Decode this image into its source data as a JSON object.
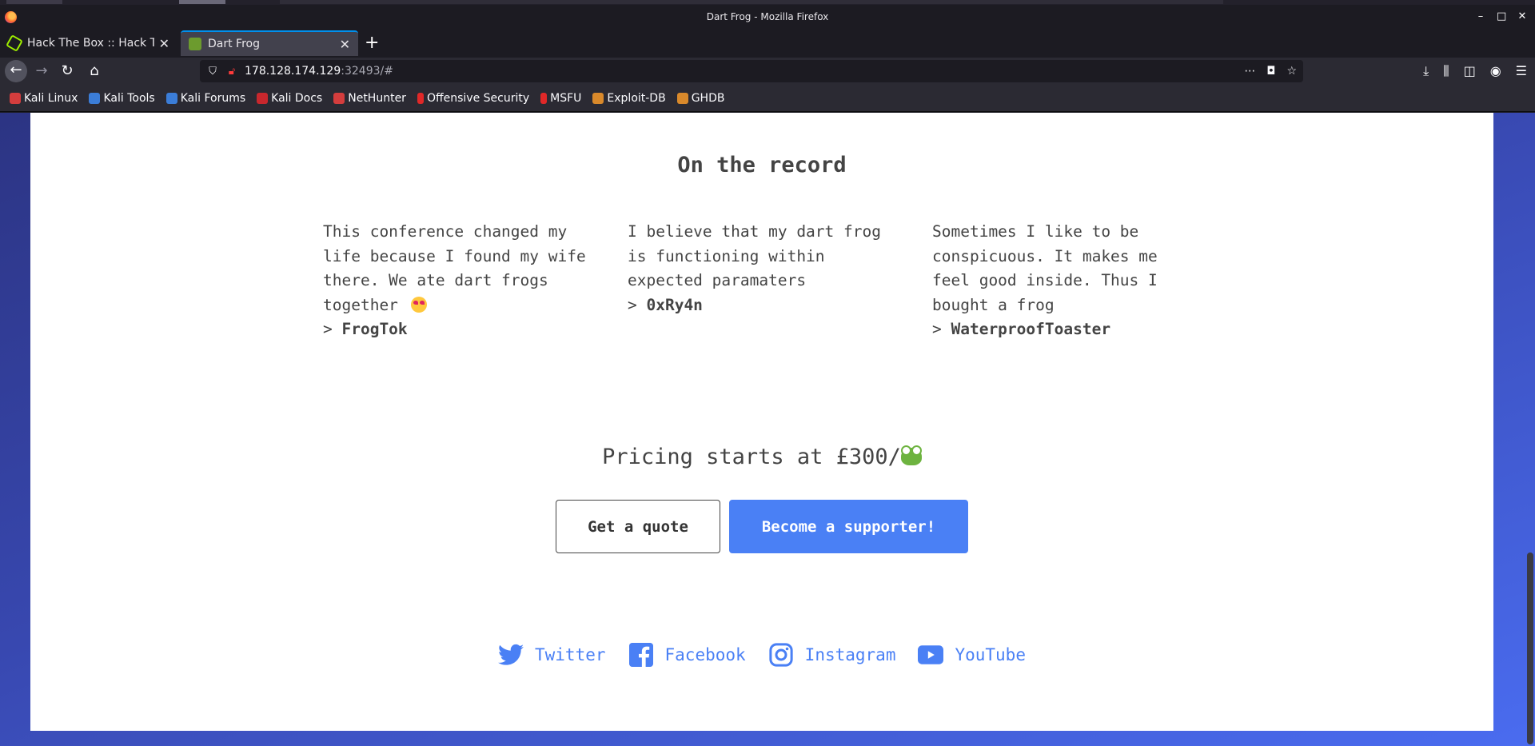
{
  "window": {
    "title": "Dart Frog - Mozilla Firefox"
  },
  "tabs": [
    {
      "label": "Hack The Box :: Hack The Box",
      "active": false
    },
    {
      "label": "Dart Frog",
      "active": true
    }
  ],
  "urlbar": {
    "host": "178.128.174.129",
    "rest": ":32493/#"
  },
  "bookmarks": [
    {
      "label": "Kali Linux",
      "icon": "kali-icon"
    },
    {
      "label": "Kali Tools",
      "icon": "kali-tools-icon"
    },
    {
      "label": "Kali Forums",
      "icon": "kali-forums-icon"
    },
    {
      "label": "Kali Docs",
      "icon": "kali-docs-icon"
    },
    {
      "label": "NetHunter",
      "icon": "nethunter-icon"
    },
    {
      "label": "Offensive Security",
      "icon": "offsec-icon"
    },
    {
      "label": "MSFU",
      "icon": "msfu-icon"
    },
    {
      "label": "Exploit-DB",
      "icon": "exploitdb-icon"
    },
    {
      "label": "GHDB",
      "icon": "ghdb-icon"
    }
  ],
  "page": {
    "section_title": "On the record",
    "testimonials": [
      {
        "quote": "This conference changed my life because I found my wife there. We ate dart frogs together",
        "author": "FrogTok"
      },
      {
        "quote": "I believe that my dart frog is functioning within expected paramaters",
        "author": "0xRy4n"
      },
      {
        "quote": "Sometimes I like to be conspicuous. It makes me feel good inside. Thus I bought a frog",
        "author": "WaterproofToaster"
      }
    ],
    "author_prefix": "> ",
    "pricing": "Pricing starts at £300/",
    "buttons": {
      "quote": "Get a quote",
      "support": "Become a supporter!"
    },
    "socials": [
      {
        "label": "Twitter",
        "icon": "twitter-icon"
      },
      {
        "label": "Facebook",
        "icon": "facebook-icon"
      },
      {
        "label": "Instagram",
        "icon": "instagram-icon"
      },
      {
        "label": "YouTube",
        "icon": "youtube-icon"
      }
    ],
    "accent_color": "#4a80f5"
  }
}
